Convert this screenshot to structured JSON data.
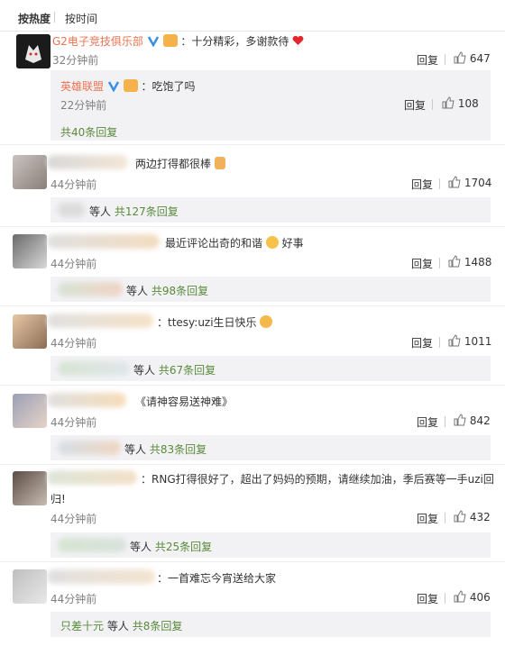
{
  "sort_tabs": {
    "hot": "按热度",
    "time": "按时间"
  },
  "reply_label": "回复",
  "comments": [
    {
      "user": "G2电子竞技俱乐部",
      "text": "：十分精彩，多谢款待",
      "time": "32分钟前",
      "likes": "647",
      "sub": {
        "user": "英雄联盟",
        "text": "：吃饱了吗",
        "time": "22分钟前",
        "likes": "108",
        "more": "共40条回复"
      }
    },
    {
      "text": "两边打得都很棒",
      "time": "44分钟前",
      "likes": "1704",
      "reply_prefix": "等人",
      "more": "共127条回复"
    },
    {
      "text": "最近评论出奇的和谐",
      "text2": "好事",
      "time": "44分钟前",
      "likes": "1488",
      "reply_prefix": "等人",
      "more": "共98条回复"
    },
    {
      "text": "：ttesy:uzi生日快乐",
      "time": "44分钟前",
      "likes": "1011",
      "reply_prefix": "等人",
      "more": "共67条回复"
    },
    {
      "text": "《请神容易送神难》",
      "time": "44分钟前",
      "likes": "842",
      "reply_prefix": "等人",
      "more": "共83条回复"
    },
    {
      "text": "：RNG打得很好了，超出了妈妈的预期，请继续加油，季后赛等一手uzi回",
      "text_line2": "归!",
      "time": "44分钟前",
      "likes": "432",
      "reply_prefix": "等人",
      "more": "共25条回复"
    },
    {
      "text": "：一首难忘今宵送给大家",
      "time": "44分钟前",
      "likes": "406",
      "reply_user": "只差十元",
      "reply_prefix": "等人",
      "more": "共8条回复"
    }
  ],
  "colors": {
    "name": "#eb7350",
    "green": "#5a8a3a",
    "gray": "#808080",
    "subbg": "#f2f2f5"
  }
}
